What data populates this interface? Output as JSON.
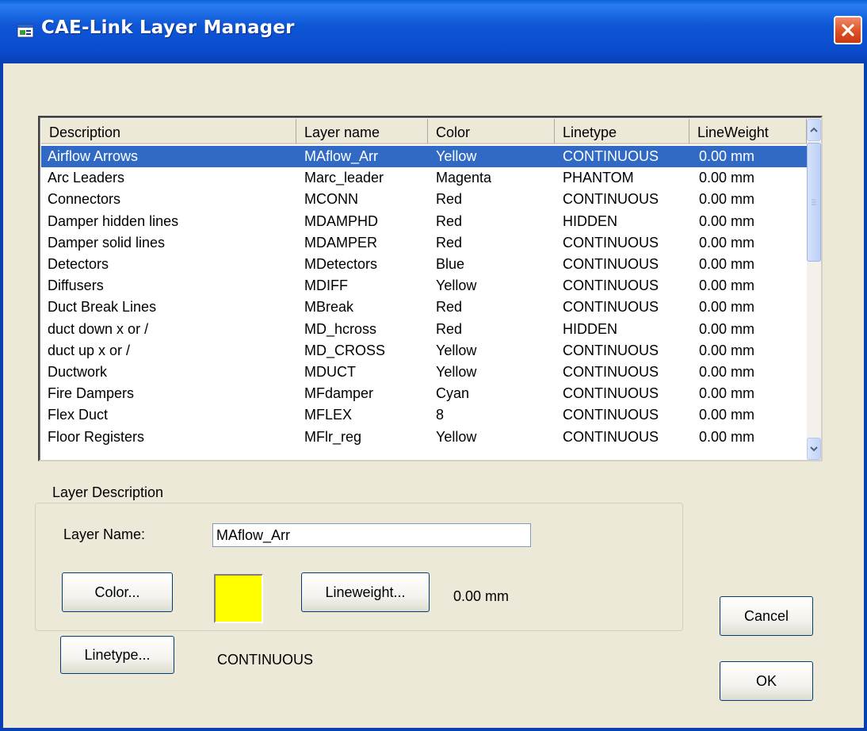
{
  "window": {
    "title": "CAE-Link Layer Manager",
    "icon": "app-window-icon",
    "close_icon": "close-icon"
  },
  "list": {
    "columns": [
      "Description",
      "Layer name",
      "Color",
      "Linetype",
      "LineWeight"
    ],
    "selected_index": 0,
    "rows": [
      [
        "Airflow Arrows",
        "MAflow_Arr",
        "Yellow",
        "CONTINUOUS",
        "0.00 mm"
      ],
      [
        "Arc Leaders",
        "Marc_leader",
        "Magenta",
        "PHANTOM",
        "0.00 mm"
      ],
      [
        "Connectors",
        "MCONN",
        "Red",
        "CONTINUOUS",
        "0.00 mm"
      ],
      [
        "Damper hidden lines",
        "MDAMPHD",
        "Red",
        "HIDDEN",
        "0.00 mm"
      ],
      [
        "Damper solid lines",
        "MDAMPER",
        "Red",
        "CONTINUOUS",
        "0.00 mm"
      ],
      [
        "Detectors",
        "MDetectors",
        "Blue",
        "CONTINUOUS",
        "0.00 mm"
      ],
      [
        "Diffusers",
        "MDIFF",
        "Yellow",
        "CONTINUOUS",
        "0.00 mm"
      ],
      [
        "Duct Break Lines",
        "MBreak",
        "Red",
        "CONTINUOUS",
        "0.00 mm"
      ],
      [
        "duct down x or /",
        "MD_hcross",
        "Red",
        "HIDDEN",
        "0.00 mm"
      ],
      [
        "duct up x or /",
        "MD_CROSS",
        "Yellow",
        "CONTINUOUS",
        "0.00 mm"
      ],
      [
        "Ductwork",
        "MDUCT",
        "Yellow",
        "CONTINUOUS",
        "0.00 mm"
      ],
      [
        "Fire Dampers",
        "MFdamper",
        "Cyan",
        "CONTINUOUS",
        "0.00 mm"
      ],
      [
        "Flex Duct",
        "MFLEX",
        "8",
        "CONTINUOUS",
        "0.00 mm"
      ],
      [
        "Floor Registers",
        "MFlr_reg",
        "Yellow",
        "CONTINUOUS",
        "0.00 mm"
      ]
    ]
  },
  "layer_description": {
    "group_title": "Layer Description",
    "layer_name_label": "Layer Name:",
    "layer_name_value": "MAflow_Arr",
    "color_button": "Color...",
    "color_swatch": "#ffff00",
    "lineweight_button": "Lineweight...",
    "lineweight_value": "0.00 mm",
    "linetype_button": "Linetype...",
    "linetype_value": "CONTINUOUS"
  },
  "buttons": {
    "cancel": "Cancel",
    "ok": "OK"
  }
}
